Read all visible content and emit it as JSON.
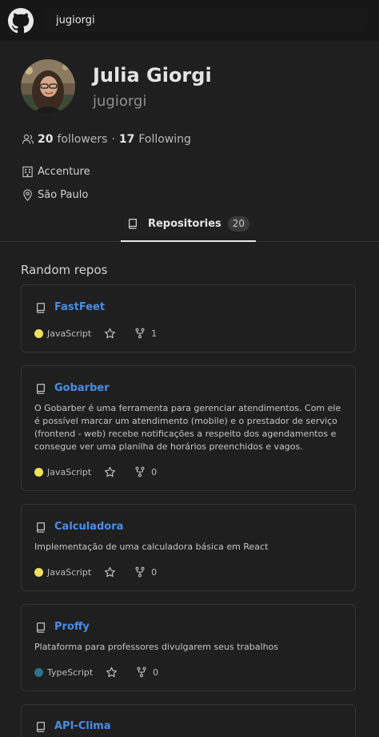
{
  "search": {
    "value": "jugiorgi"
  },
  "profile": {
    "name": "Julia Giorgi",
    "login": "jugiorgi",
    "followers_count": "20",
    "followers_label": "followers",
    "separator": "·",
    "following_count": "17",
    "following_label": "Following",
    "company": "Accenture",
    "location": "São Paulo"
  },
  "tabs": {
    "repositories_label": "Repositories",
    "repositories_count": "20"
  },
  "section": {
    "title": "Random repos"
  },
  "repos": [
    {
      "name": "FastFeet",
      "description": "",
      "language": "JavaScript",
      "language_color": "#f1e05a",
      "forks": "1"
    },
    {
      "name": "Gobarber",
      "description": "O Gobarber é uma ferramenta para gerenciar atendimentos. Com ele é possível marcar um atendimento (mobile) e o prestador de serviço (frontend - web) recebe notificações a respeito dos agendamentos e consegue ver uma planilha de horários preenchidos e vagos.",
      "language": "JavaScript",
      "language_color": "#f1e05a",
      "forks": "0"
    },
    {
      "name": "Calculadora",
      "description": "Implementação de uma calculadora básica em React",
      "language": "JavaScript",
      "language_color": "#f1e05a",
      "forks": "0"
    },
    {
      "name": "Proffy",
      "description": "Plataforma para professores divulgarem seus trabalhos",
      "language": "TypeScript",
      "language_color": "#2b7489",
      "forks": "0"
    },
    {
      "name": "API-Clima",
      "description": "",
      "language": "",
      "language_color": "",
      "forks": ""
    }
  ],
  "colors": {
    "link": "#4a8de8",
    "background": "#1f1f1f",
    "header": "#161616"
  }
}
